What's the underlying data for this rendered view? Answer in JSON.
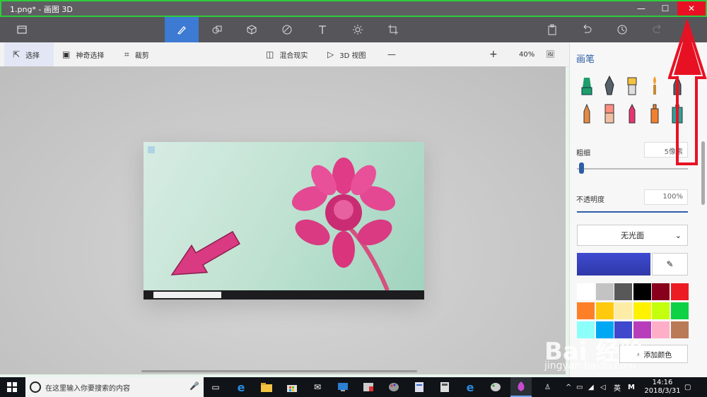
{
  "window": {
    "title": "1.png* - 画图 3D",
    "minimize_icon": "minimize-icon",
    "maximize_icon": "maximize-icon",
    "close_icon": "close-icon",
    "frame_highlight_color": "#2ecc3a",
    "close_color": "#e81123"
  },
  "toolbar": {
    "menu_icon": "menu-icon",
    "tools": [
      "art-tools-icon",
      "2d-shapes-icon",
      "3d-shapes-icon",
      "stickers-icon",
      "text-icon",
      "effects-icon",
      "canvas-icon"
    ],
    "active_tool": "art-tools-icon",
    "right_icons": [
      "paste-icon",
      "undo-icon",
      "history-icon",
      "redo-icon"
    ]
  },
  "subbar": {
    "select": "选择",
    "magic_select": "神奇选择",
    "crop": "裁剪",
    "mixed_reality": "混合现实",
    "view_3d": "3D 视图",
    "zoom_minus": "—",
    "zoom_plus": "+",
    "zoom_value": "40%",
    "zoom_level": 0.4
  },
  "panel": {
    "title": "画笔",
    "thickness_label": "粗细",
    "thickness_value": "5像素",
    "opacity_label": "不透明度",
    "opacity_value": "100%",
    "finish_value": "无光面",
    "add_color_label": "+ 添加颜色",
    "current_color": "#3c45c4",
    "palette": [
      "#ffffff",
      "#c3c3c3",
      "#585858",
      "#000000",
      "#88001b",
      "#ec1c24",
      "#ff7f27",
      "#ffc90e",
      "#fdeca6",
      "#fff200",
      "#c4ff0e",
      "#0ed145",
      "#8cfffb",
      "#00a8f3",
      "#3f48cc",
      "#b83dba",
      "#ffaec8",
      "#b97a56"
    ]
  },
  "taskbar": {
    "search_placeholder": "在这里输入你要搜索的内容",
    "ime": "英",
    "time": "14:16",
    "date": "2018/3/31",
    "notification": "M"
  },
  "watermark": {
    "text": "Bai 经验",
    "url": "jingyan.baidu.com"
  }
}
